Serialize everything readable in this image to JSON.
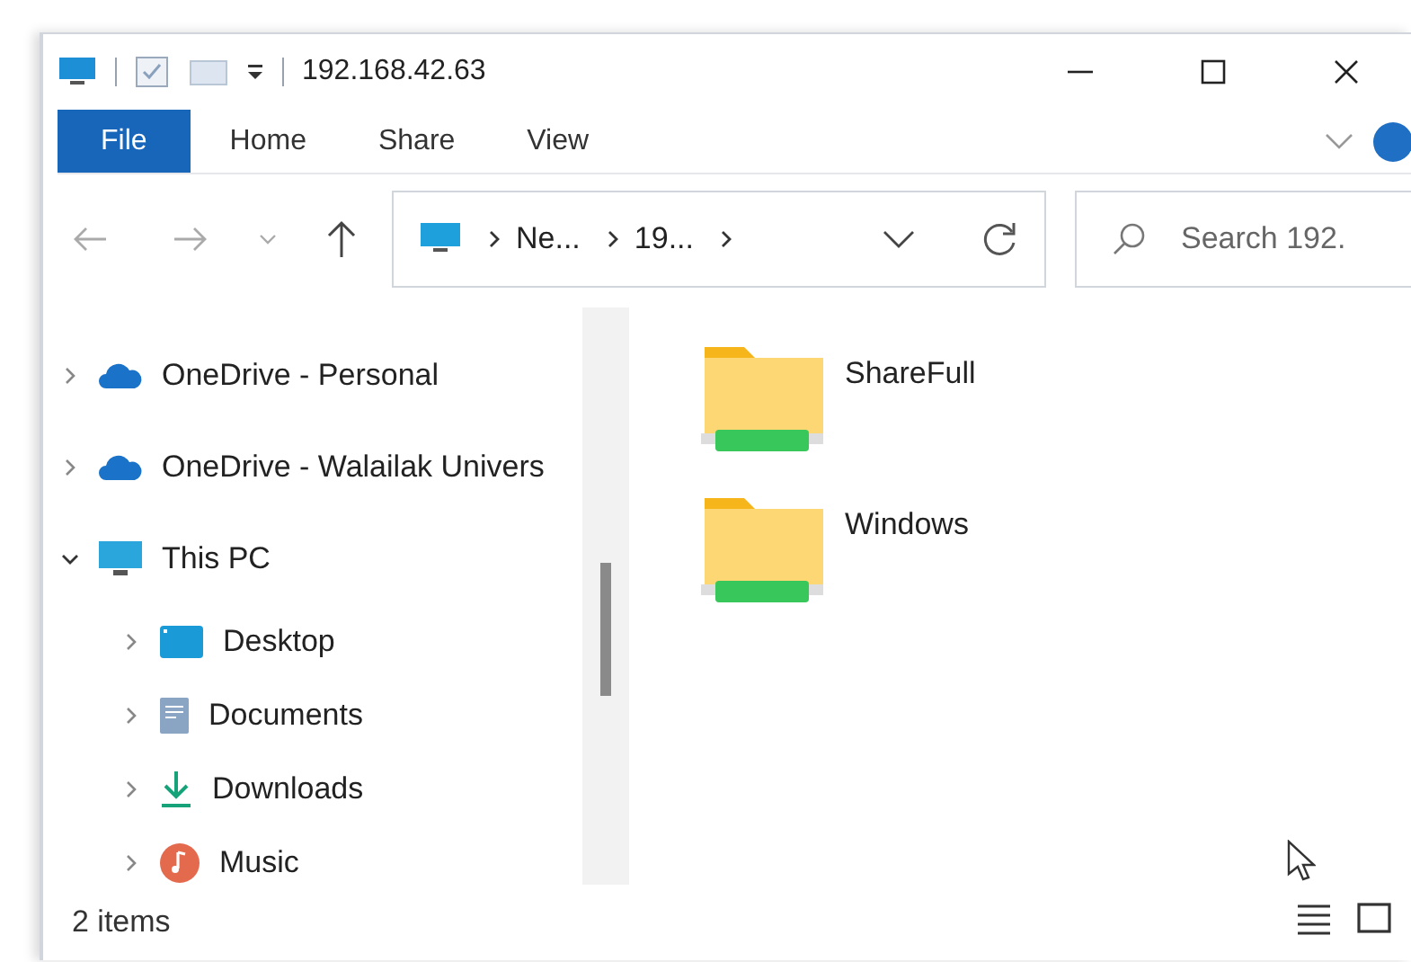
{
  "window": {
    "title": "192.168.42.63"
  },
  "ribbon_tabs": [
    {
      "label": "File",
      "selected": true
    },
    {
      "label": "Home",
      "selected": false
    },
    {
      "label": "Share",
      "selected": false
    },
    {
      "label": "View",
      "selected": false
    }
  ],
  "address_bar": {
    "segments": [
      "Ne...",
      "19..."
    ]
  },
  "search": {
    "placeholder": "Search 192."
  },
  "navigation": [
    {
      "kind": "cloud",
      "label": "OneDrive - Personal",
      "expanded": false
    },
    {
      "kind": "cloud",
      "label": "OneDrive - Walailak Univers",
      "expanded": false
    },
    {
      "kind": "pc",
      "label": "This PC",
      "expanded": true,
      "children": [
        {
          "kind": "desktop",
          "label": "Desktop",
          "expanded": false
        },
        {
          "kind": "documents",
          "label": "Documents",
          "expanded": false
        },
        {
          "kind": "downloads",
          "label": "Downloads",
          "expanded": false
        },
        {
          "kind": "music",
          "label": "Music",
          "expanded": false
        }
      ]
    }
  ],
  "items": [
    {
      "label": "ShareFull"
    },
    {
      "label": "Windows"
    }
  ],
  "status_bar": {
    "count": "2 items"
  }
}
